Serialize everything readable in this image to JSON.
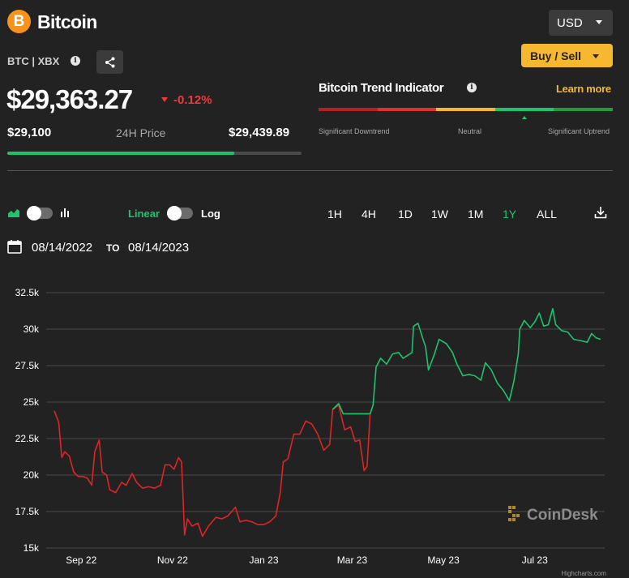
{
  "header": {
    "logo_symbol": "B",
    "coin_name": "Bitcoin",
    "ticker": "BTC | XBX",
    "currency": "USD",
    "buy_sell": "Buy / Sell",
    "icons": [
      "bitcoin-logo",
      "info-icon",
      "share-icon",
      "chevron-down-icon"
    ]
  },
  "price": {
    "current": "$29,363.27",
    "change": "-0.12%",
    "change_color": "#ee3a3a",
    "low": "$29,100",
    "label": "24H Price",
    "high": "$29,439.89",
    "range_position": 0.77
  },
  "trend": {
    "title": "Bitcoin Trend Indicator",
    "learn_more": "Learn more",
    "segments": [
      "#b51f1f",
      "#e03030",
      "#f5b82e",
      "#1ec36e",
      "#1f9d3a"
    ],
    "current_segment": 3,
    "labels": [
      "Significant Downtrend",
      "Neutral",
      "Significant Uptrend"
    ]
  },
  "controls": {
    "linear": "Linear",
    "log": "Log",
    "ranges": [
      "1H",
      "4H",
      "1D",
      "1W",
      "1M",
      "1Y",
      "ALL"
    ],
    "active_range": "1Y",
    "date_from": "08/14/2022",
    "to_label": "TO",
    "date_to": "08/14/2023",
    "icons": [
      "area-chart-icon",
      "bar-chart-icon",
      "calendar-icon",
      "download-icon"
    ]
  },
  "colors": {
    "accent": "#f5b82e",
    "up": "#1ec36e",
    "down": "#e02424",
    "background": "#222222"
  },
  "chart_data": {
    "type": "line",
    "title": "",
    "xlabel": "",
    "ylabel": "",
    "ylim": [
      15000,
      32500
    ],
    "yticks": [
      15000,
      17500,
      20000,
      22500,
      25000,
      27500,
      30000,
      32500
    ],
    "ytick_labels": [
      "15k",
      "17.5k",
      "20k",
      "22.5k",
      "25k",
      "27.5k",
      "30k",
      "32.5k"
    ],
    "x_range": [
      "2022-08-14",
      "2023-08-14"
    ],
    "xticks": [
      "2022-09-01",
      "2022-11-01",
      "2023-01-01",
      "2023-03-01",
      "2023-05-01",
      "2023-07-01"
    ],
    "xtick_labels": [
      "Sep 22",
      "Nov 22",
      "Jan 23",
      "Mar 23",
      "May 23",
      "Jul 23"
    ],
    "grid": true,
    "legend": "none",
    "watermark": "CoinDesk",
    "credit": "Highcharts.com",
    "series": [
      {
        "color": "#e02424",
        "points": [
          [
            "2022-08-14",
            24400
          ],
          [
            "2022-08-17",
            23600
          ],
          [
            "2022-08-19",
            21200
          ],
          [
            "2022-08-21",
            21600
          ],
          [
            "2022-08-24",
            21300
          ],
          [
            "2022-08-27",
            20200
          ],
          [
            "2022-08-30",
            19900
          ],
          [
            "2022-09-02",
            19900
          ],
          [
            "2022-09-05",
            19800
          ],
          [
            "2022-09-08",
            19300
          ],
          [
            "2022-09-10",
            21600
          ],
          [
            "2022-09-13",
            22400
          ],
          [
            "2022-09-15",
            20200
          ],
          [
            "2022-09-18",
            20000
          ],
          [
            "2022-09-20",
            19000
          ],
          [
            "2022-09-24",
            18800
          ],
          [
            "2022-09-28",
            19500
          ],
          [
            "2022-10-01",
            19300
          ],
          [
            "2022-10-05",
            20100
          ],
          [
            "2022-10-08",
            19500
          ],
          [
            "2022-10-12",
            19100
          ],
          [
            "2022-10-16",
            19200
          ],
          [
            "2022-10-20",
            19100
          ],
          [
            "2022-10-24",
            19300
          ],
          [
            "2022-10-27",
            20700
          ],
          [
            "2022-10-30",
            20700
          ],
          [
            "2022-11-02",
            20400
          ],
          [
            "2022-11-05",
            21200
          ],
          [
            "2022-11-07",
            20900
          ],
          [
            "2022-11-08",
            18500
          ],
          [
            "2022-11-09",
            15900
          ],
          [
            "2022-11-11",
            17000
          ],
          [
            "2022-11-14",
            16500
          ],
          [
            "2022-11-18",
            16700
          ],
          [
            "2022-11-21",
            15800
          ],
          [
            "2022-11-25",
            16500
          ],
          [
            "2022-11-30",
            17100
          ],
          [
            "2022-12-04",
            17000
          ],
          [
            "2022-12-08",
            17200
          ],
          [
            "2022-12-13",
            17800
          ],
          [
            "2022-12-16",
            16800
          ],
          [
            "2022-12-20",
            16900
          ],
          [
            "2022-12-24",
            16800
          ],
          [
            "2022-12-28",
            16600
          ],
          [
            "2023-01-01",
            16600
          ],
          [
            "2023-01-05",
            16800
          ],
          [
            "2023-01-09",
            17200
          ],
          [
            "2023-01-12",
            18800
          ],
          [
            "2023-01-14",
            20900
          ],
          [
            "2023-01-17",
            21100
          ],
          [
            "2023-01-21",
            22800
          ],
          [
            "2023-01-25",
            22800
          ],
          [
            "2023-01-29",
            23700
          ],
          [
            "2023-02-02",
            23500
          ],
          [
            "2023-02-06",
            22800
          ],
          [
            "2023-02-10",
            21700
          ],
          [
            "2023-02-14",
            22100
          ],
          [
            "2023-02-16",
            24500
          ],
          [
            "2023-02-20",
            24800
          ],
          [
            "2023-02-24",
            23100
          ],
          [
            "2023-02-28",
            23300
          ],
          [
            "2023-03-03",
            22300
          ],
          [
            "2023-03-06",
            22400
          ],
          [
            "2023-03-09",
            20300
          ],
          [
            "2023-03-11",
            20600
          ],
          [
            "2023-03-13",
            24200
          ]
        ]
      },
      {
        "color": "#1ec36e",
        "points": [
          [
            "2023-02-16",
            24500
          ],
          [
            "2023-02-20",
            24900
          ],
          [
            "2023-02-23",
            24200
          ],
          [
            "2023-03-13",
            24200
          ],
          [
            "2023-03-15",
            24800
          ],
          [
            "2023-03-17",
            27400
          ],
          [
            "2023-03-20",
            28000
          ],
          [
            "2023-03-24",
            27600
          ],
          [
            "2023-03-28",
            28300
          ],
          [
            "2023-04-01",
            28400
          ],
          [
            "2023-04-04",
            28000
          ],
          [
            "2023-04-10",
            28400
          ],
          [
            "2023-04-11",
            30200
          ],
          [
            "2023-04-14",
            30400
          ],
          [
            "2023-04-17",
            29400
          ],
          [
            "2023-04-19",
            28800
          ],
          [
            "2023-04-21",
            27200
          ],
          [
            "2023-04-25",
            28300
          ],
          [
            "2023-04-28",
            29300
          ],
          [
            "2023-05-03",
            29000
          ],
          [
            "2023-05-07",
            28400
          ],
          [
            "2023-05-10",
            27600
          ],
          [
            "2023-05-14",
            26800
          ],
          [
            "2023-05-18",
            26900
          ],
          [
            "2023-05-22",
            26800
          ],
          [
            "2023-05-26",
            26500
          ],
          [
            "2023-05-29",
            27700
          ],
          [
            "2023-06-02",
            27200
          ],
          [
            "2023-06-06",
            26300
          ],
          [
            "2023-06-10",
            25800
          ],
          [
            "2023-06-14",
            25100
          ],
          [
            "2023-06-17",
            26400
          ],
          [
            "2023-06-20",
            28300
          ],
          [
            "2023-06-21",
            30000
          ],
          [
            "2023-06-24",
            30600
          ],
          [
            "2023-06-28",
            30100
          ],
          [
            "2023-07-01",
            30500
          ],
          [
            "2023-07-04",
            31100
          ],
          [
            "2023-07-07",
            30200
          ],
          [
            "2023-07-10",
            30300
          ],
          [
            "2023-07-13",
            31400
          ],
          [
            "2023-07-15",
            30300
          ],
          [
            "2023-07-19",
            29900
          ],
          [
            "2023-07-23",
            29800
          ],
          [
            "2023-07-27",
            29300
          ],
          [
            "2023-08-01",
            29200
          ],
          [
            "2023-08-05",
            29100
          ],
          [
            "2023-08-08",
            29700
          ],
          [
            "2023-08-11",
            29400
          ],
          [
            "2023-08-14",
            29300
          ]
        ]
      }
    ]
  }
}
